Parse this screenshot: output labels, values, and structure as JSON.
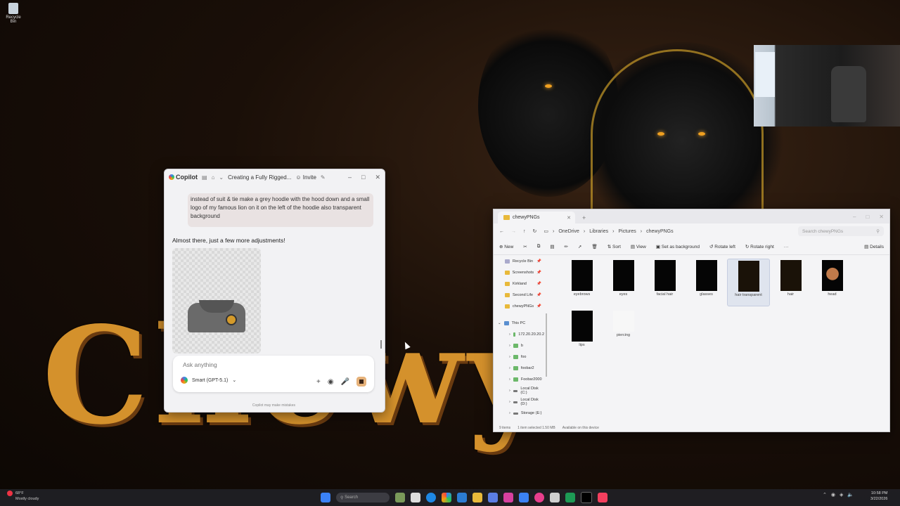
{
  "desktop": {
    "recycle_bin_label": "Recycle Bin",
    "banner_text": "Chewy K"
  },
  "copilot": {
    "app_name": "Copilot",
    "conversation_title": "Creating a Fully Rigged...",
    "invite_label": "Invite",
    "user_message": "instead of suit & tie make a grey hoodie with the hood down and a small logo of my famous lion on it on the left of the hoodie also transparent background",
    "reply_text": "Almost there, just a few more adjustments!",
    "input_placeholder": "Ask anything",
    "model_label": "Smart (GPT-5.1)",
    "disclaimer": "Copilot may make mistakes"
  },
  "explorer": {
    "tab_title": "chewyPNGs",
    "breadcrumb": [
      "OneDrive",
      "Libraries",
      "Pictures",
      "chewyPNGs"
    ],
    "search_placeholder": "Search chewyPNGs",
    "toolbar": {
      "new": "New",
      "sort": "Sort",
      "view": "View",
      "set_background": "Set as background",
      "rotate_left": "Rotate left",
      "rotate_right": "Rotate right",
      "more": "···",
      "details": "Details"
    },
    "nav_quick": [
      {
        "label": "Recycle Bin"
      },
      {
        "label": "Screenshots"
      },
      {
        "label": "Kirkland"
      },
      {
        "label": "Second Life"
      },
      {
        "label": "chewyPNGs"
      }
    ],
    "nav_this_pc": "This PC",
    "nav_drives": [
      {
        "label": "172.20.20.20.2"
      },
      {
        "label": "b"
      },
      {
        "label": "foo"
      },
      {
        "label": "foobar2"
      },
      {
        "label": "Foobar2000"
      },
      {
        "label": "Local Disk (C:)"
      },
      {
        "label": "Local Disk (D:)"
      },
      {
        "label": "Storage (E:)"
      }
    ],
    "files": [
      {
        "name": "eyebrows"
      },
      {
        "name": "eyes"
      },
      {
        "name": "facial hair"
      },
      {
        "name": "glasses"
      },
      {
        "name": "hair transparent"
      },
      {
        "name": "hair"
      },
      {
        "name": "head"
      },
      {
        "name": "lips"
      },
      {
        "name": "piercing"
      }
    ],
    "status": {
      "items": "9 items",
      "selected": "1 item selected  1.50 MB",
      "availability": "Available on this device"
    }
  },
  "taskbar": {
    "weather_temp": "68°F",
    "weather_desc": "Mostly cloudy",
    "search_label": "Search",
    "time": "10:58 PM",
    "date": "3/22/2026"
  }
}
